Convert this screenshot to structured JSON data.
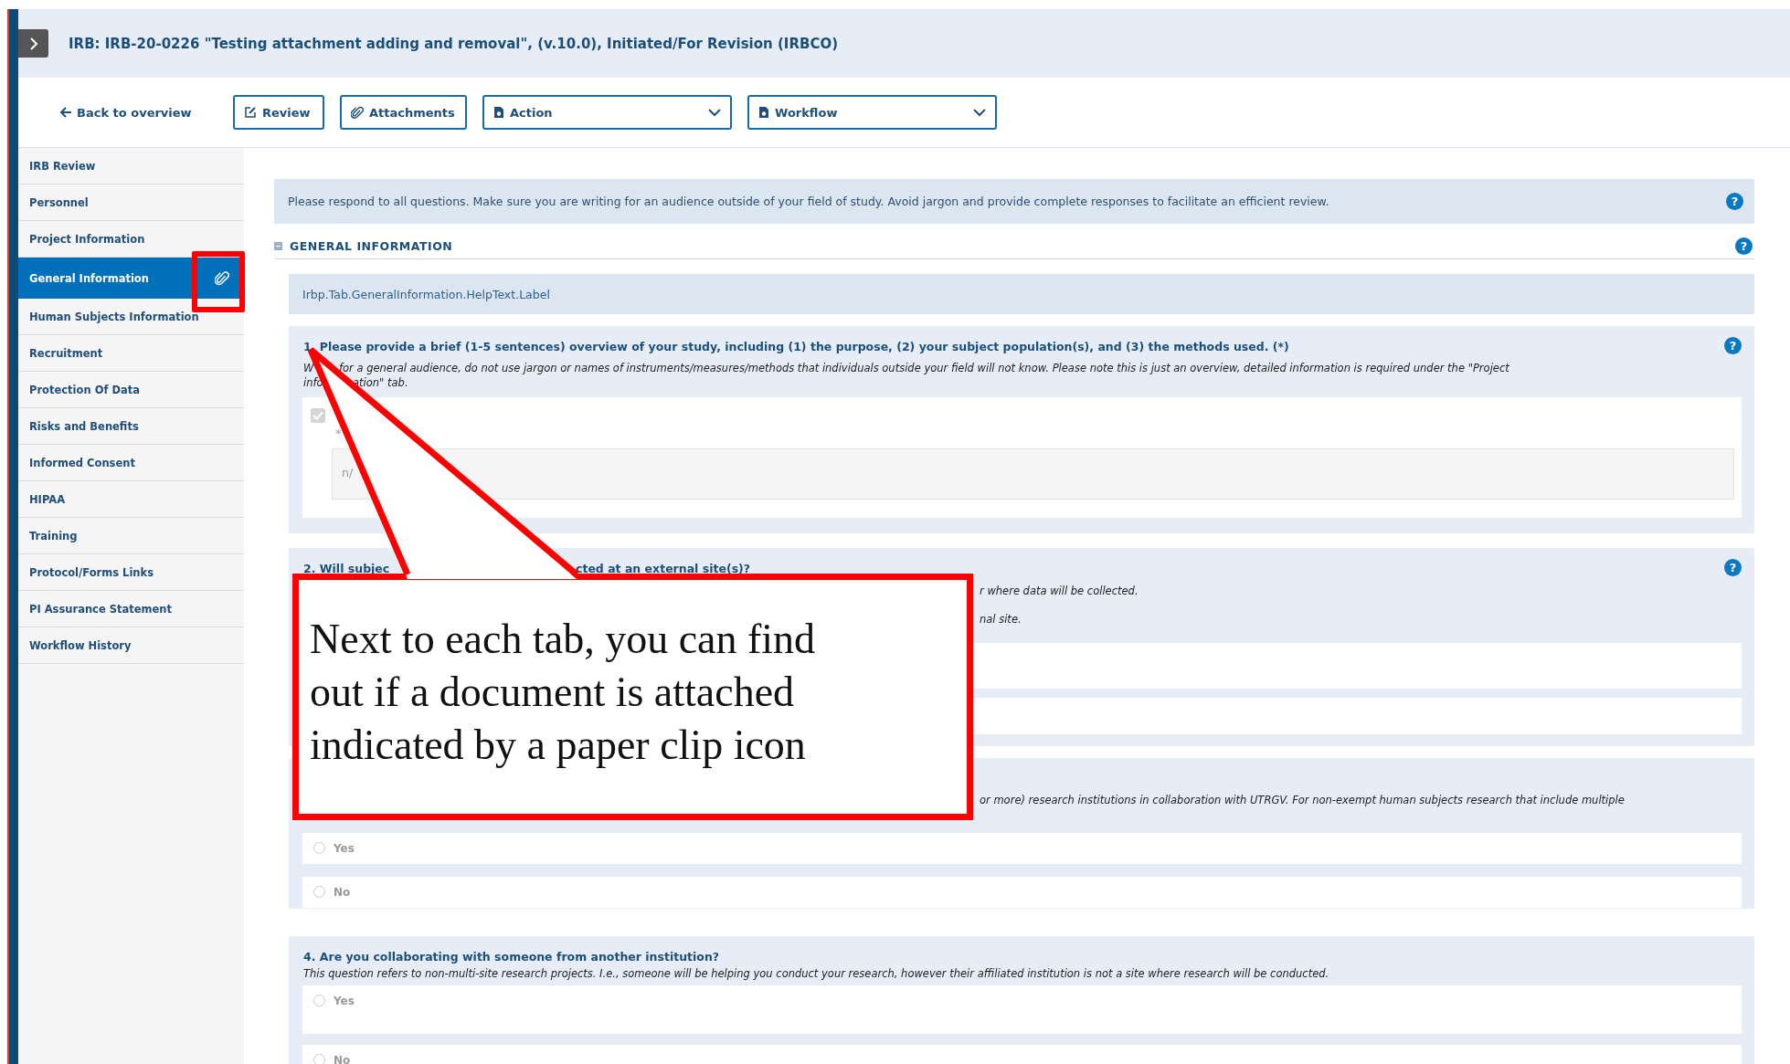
{
  "title": "IRB: IRB-20-0226 \"Testing attachment adding and removal\", (v.10.0), Initiated/For Revision (IRBCO)",
  "toolbar": {
    "back": "Back to overview",
    "buttons": [
      {
        "label": "Review",
        "kind": "edit"
      },
      {
        "label": "Attachments",
        "kind": "attach"
      },
      {
        "label": "Action",
        "kind": "menu"
      },
      {
        "label": "Workflow",
        "kind": "menu"
      }
    ]
  },
  "sidebar": {
    "items": [
      {
        "label": "IRB Review",
        "selected": false,
        "has_attachment": false
      },
      {
        "label": "Personnel",
        "selected": false,
        "has_attachment": false
      },
      {
        "label": "Project Information",
        "selected": false,
        "has_attachment": false
      },
      {
        "label": "General Information",
        "selected": true,
        "has_attachment": true
      },
      {
        "label": "Human Subjects Information",
        "selected": false,
        "has_attachment": false
      },
      {
        "label": "Recruitment",
        "selected": false,
        "has_attachment": false
      },
      {
        "label": "Protection Of Data",
        "selected": false,
        "has_attachment": false
      },
      {
        "label": "Risks and Benefits",
        "selected": false,
        "has_attachment": false
      },
      {
        "label": "Informed Consent",
        "selected": false,
        "has_attachment": false
      },
      {
        "label": "HIPAA",
        "selected": false,
        "has_attachment": false
      },
      {
        "label": "Training",
        "selected": false,
        "has_attachment": false
      },
      {
        "label": "Protocol/Forms Links",
        "selected": false,
        "has_attachment": false
      },
      {
        "label": "PI Assurance Statement",
        "selected": false,
        "has_attachment": false
      },
      {
        "label": "Workflow History",
        "selected": false,
        "has_attachment": false
      }
    ]
  },
  "banner": {
    "text": "Please respond to all questions. Make sure you are writing for an audience outside of your field of study. Avoid jargon and provide complete responses to facilitate an efficient review.",
    "help": "?"
  },
  "section": {
    "title": "GENERAL INFORMATION",
    "expanded": true,
    "help": "?"
  },
  "help_label": "Irbp.Tab.GeneralInformation.HelpText.Label",
  "questions": [
    {
      "kind": "text",
      "title_segments": [
        "1. Please provide a brief (1-5 sentences) overview of your study, including (1) the purpose, (2) your subject population(s), and (3) the methods used. (*)"
      ],
      "help": "?",
      "hint_lines": [
        [
          "W",
          "for a general audience, do not use jargon or names of instruments/measures/methods that individuals outside your field will not know. Please note this is just an overview, detailed information is required under the \"Project"
        ],
        [
          "info",
          "ation\" tab."
        ]
      ],
      "checkbox": {
        "checked": true,
        "disabled": true
      },
      "required_mark": "*",
      "value": "n/"
    },
    {
      "kind": "blank",
      "title_segments": [
        "2. Will subjec",
        "cted at an external site(s)?"
      ],
      "help": "?",
      "hint_lines": [
        [
          "r where data will be collected."
        ],
        [
          "nal site."
        ]
      ]
    },
    {
      "kind": "choice",
      "hint_lines": [
        [
          "or more) research institutions in collaboration with UTRGV. For non-exempt human subjects research that include multiple"
        ]
      ],
      "options": [
        {
          "label": "Yes",
          "selected": false
        },
        {
          "label": "No",
          "selected": false
        }
      ]
    },
    {
      "kind": "choice",
      "title_segments": [
        "4. Are you collaborating with someone from another institution?"
      ],
      "hint_lines": [
        [
          "This question refers to non-multi-site research projects. I.e., someone will be helping you conduct your research, however their affiliated institution is not a site where research will be conducted."
        ]
      ],
      "options": [
        {
          "label": "Yes",
          "selected": false
        },
        {
          "label": "No",
          "selected": false
        }
      ]
    }
  ],
  "callout": {
    "text": "Next to each tab, you can find\nout if a document is attached\nindicated by a paper clip icon"
  }
}
